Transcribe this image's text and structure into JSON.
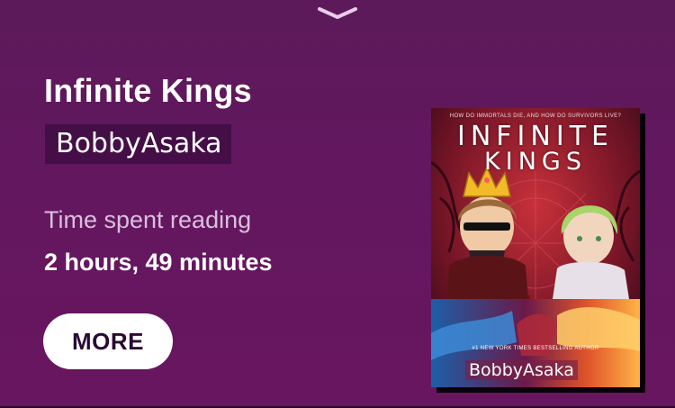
{
  "header": {
    "collapse_icon": "chevron-down-icon"
  },
  "book": {
    "title": "Infinite Kings",
    "author": "BobbyAsaka",
    "time_label": "Time spent reading",
    "time_value": "2 hours, 49 minutes",
    "more_label": "MORE"
  },
  "cover": {
    "tagline": "HOW DO IMMORTALS DIE, AND HOW DO SURVIVORS LIVE?",
    "title_line1": "INFINITE",
    "title_line2": "KINGS",
    "bestseller": "#1 NEW YORK TIMES BESTSELLING AUTHOR",
    "author": "BobbyAsaka"
  },
  "colors": {
    "background": "#63175f",
    "text": "#ffffff",
    "muted_text": "#d9bfdc",
    "button_bg": "#ffffff",
    "button_text": "#2a0a33"
  }
}
